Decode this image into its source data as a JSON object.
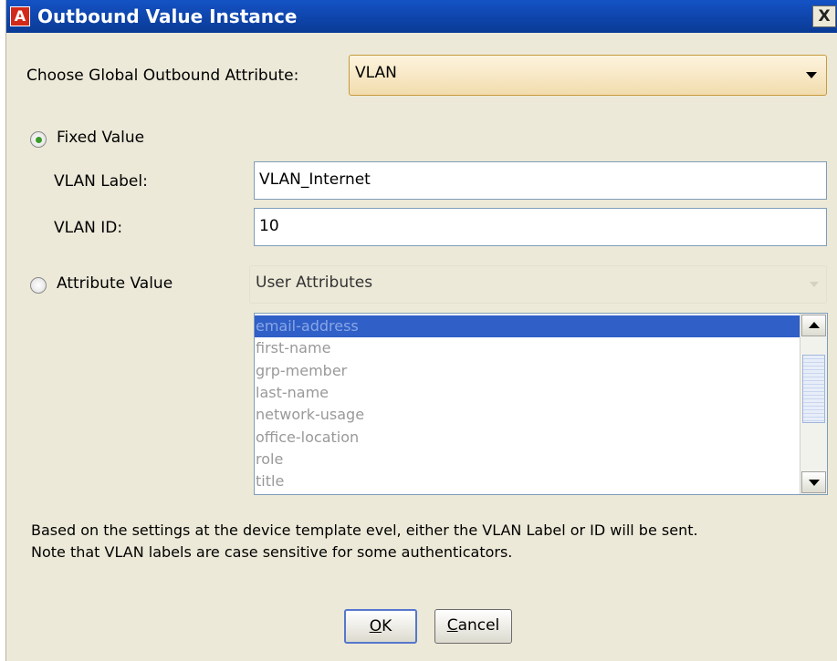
{
  "window": {
    "title": "Outbound Value Instance",
    "icon": "app-icon",
    "close_label": "X"
  },
  "global_attribute": {
    "label": "Choose Global Outbound Attribute:",
    "selected": "VLAN"
  },
  "fixed_value": {
    "label": "Fixed Value",
    "selected": true,
    "vlan_label": {
      "label": "VLAN Label:",
      "value": "VLAN_Internet"
    },
    "vlan_id": {
      "label": "VLAN ID:",
      "value": "10"
    }
  },
  "attribute_value": {
    "label": "Attribute Value",
    "selected": false,
    "source_selected": "User Attributes",
    "items": [
      "email-address",
      "first-name",
      "grp-member",
      "last-name",
      "network-usage",
      "office-location",
      "role",
      "title"
    ],
    "selected_index": 0
  },
  "info": {
    "line1": "Based on the settings at the device template evel, either the VLAN Label or ID will be sent.",
    "line2": "Note that VLAN labels are case sensitive for some authenticators."
  },
  "buttons": {
    "ok": {
      "mnemonic": "O",
      "rest": "K"
    },
    "cancel": {
      "mnemonic": "C",
      "rest": "ancel"
    }
  },
  "colors": {
    "titlebar": "#0b3f9e",
    "dialog_bg": "#ece9d8",
    "selection": "#2f5fc7",
    "radio_dot": "#3a9a2a"
  }
}
